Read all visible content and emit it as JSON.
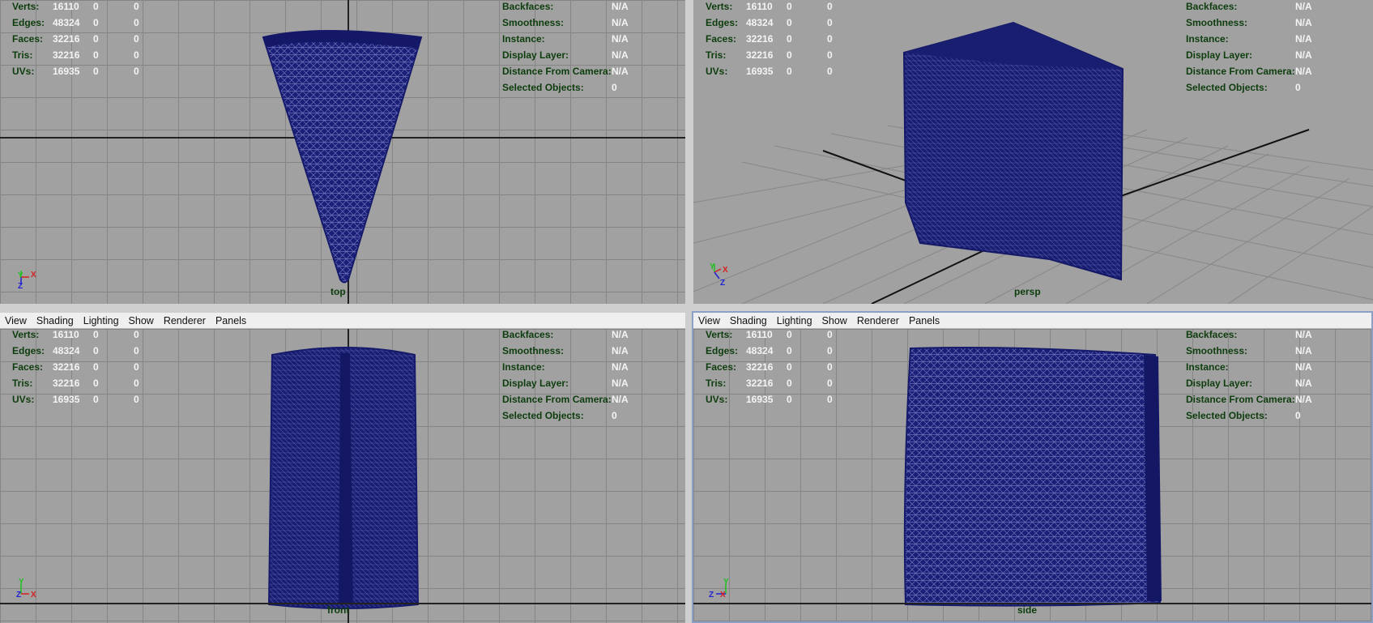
{
  "menu": [
    "View",
    "Shading",
    "Lighting",
    "Show",
    "Renderer",
    "Panels"
  ],
  "poly_stats": [
    {
      "label": "Verts:",
      "v1": "16110",
      "v2": "0",
      "v3": "0"
    },
    {
      "label": "Edges:",
      "v1": "48324",
      "v2": "0",
      "v3": "0"
    },
    {
      "label": "Faces:",
      "v1": "32216",
      "v2": "0",
      "v3": "0"
    },
    {
      "label": "Tris:",
      "v1": "32216",
      "v2": "0",
      "v3": "0"
    },
    {
      "label": "UVs:",
      "v1": "16935",
      "v2": "0",
      "v3": "0"
    }
  ],
  "object_info": [
    {
      "label": "Backfaces:",
      "value": "N/A"
    },
    {
      "label": "Smoothness:",
      "value": "N/A"
    },
    {
      "label": "Instance:",
      "value": "N/A"
    },
    {
      "label": "Display Layer:",
      "value": "N/A"
    },
    {
      "label": "Distance From Camera:",
      "value": "N/A"
    },
    {
      "label": "Selected Objects:",
      "value": "0"
    }
  ],
  "viewports": {
    "top": {
      "camera": "top"
    },
    "persp": {
      "camera": "persp"
    },
    "front": {
      "camera": "front"
    },
    "side": {
      "camera": "side"
    }
  },
  "colors": {
    "mesh": "#1b1f78",
    "viewport_bg": "#a1a1a1",
    "grid": "#858585",
    "hud_label": "#0d3d0d",
    "hud_value": "#f4f4f4",
    "axis_x": "#d42020",
    "axis_y": "#20c020",
    "axis_z": "#2020d4"
  },
  "gizmos": {
    "top": [
      "Y",
      "X",
      "Z"
    ],
    "persp": [
      "Y",
      "X",
      "Z"
    ],
    "front": [
      "Y",
      "Z",
      "X"
    ],
    "side": [
      "Y",
      "Z",
      "X"
    ]
  }
}
